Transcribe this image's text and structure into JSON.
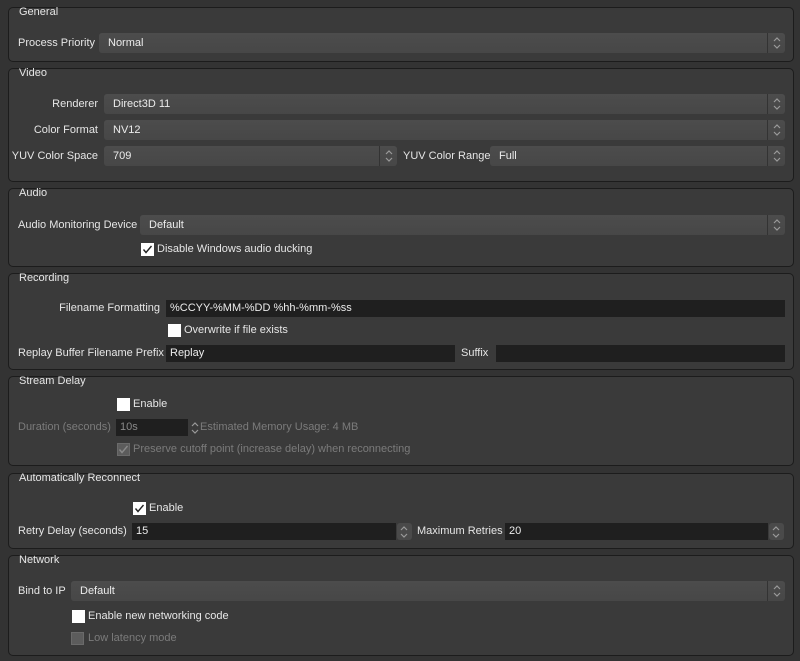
{
  "general": {
    "title": "General",
    "process_priority_label": "Process Priority",
    "process_priority_value": "Normal"
  },
  "video": {
    "title": "Video",
    "renderer_label": "Renderer",
    "renderer_value": "Direct3D 11",
    "color_format_label": "Color Format",
    "color_format_value": "NV12",
    "yuv_color_space_label": "YUV Color Space",
    "yuv_color_space_value": "709",
    "yuv_color_range_label": "YUV Color Range",
    "yuv_color_range_value": "Full"
  },
  "audio": {
    "title": "Audio",
    "monitoring_device_label": "Audio Monitoring Device",
    "monitoring_device_value": "Default",
    "disable_ducking_label": "Disable Windows audio ducking",
    "disable_ducking_checked": true
  },
  "recording": {
    "title": "Recording",
    "filename_formatting_label": "Filename Formatting",
    "filename_formatting_value": "%CCYY-%MM-%DD %hh-%mm-%ss",
    "overwrite_label": "Overwrite if file exists",
    "overwrite_checked": false,
    "replay_prefix_label": "Replay Buffer Filename Prefix",
    "replay_prefix_value": "Replay",
    "suffix_label": "Suffix",
    "suffix_value": ""
  },
  "stream_delay": {
    "title": "Stream Delay",
    "enable_label": "Enable",
    "enable_checked": false,
    "duration_label": "Duration (seconds)",
    "duration_value": "10s",
    "memory_usage": "Estimated Memory Usage: 4 MB",
    "preserve_label": "Preserve cutoff point (increase delay) when reconnecting",
    "preserve_checked": true
  },
  "auto_reconnect": {
    "title": "Automatically Reconnect",
    "enable_label": "Enable",
    "enable_checked": true,
    "retry_delay_label": "Retry Delay (seconds)",
    "retry_delay_value": "15",
    "max_retries_label": "Maximum Retries",
    "max_retries_value": "20"
  },
  "network": {
    "title": "Network",
    "bind_ip_label": "Bind to IP",
    "bind_ip_value": "Default",
    "new_networking_label": "Enable new networking code",
    "new_networking_checked": false,
    "low_latency_label": "Low latency mode",
    "low_latency_checked": false
  }
}
